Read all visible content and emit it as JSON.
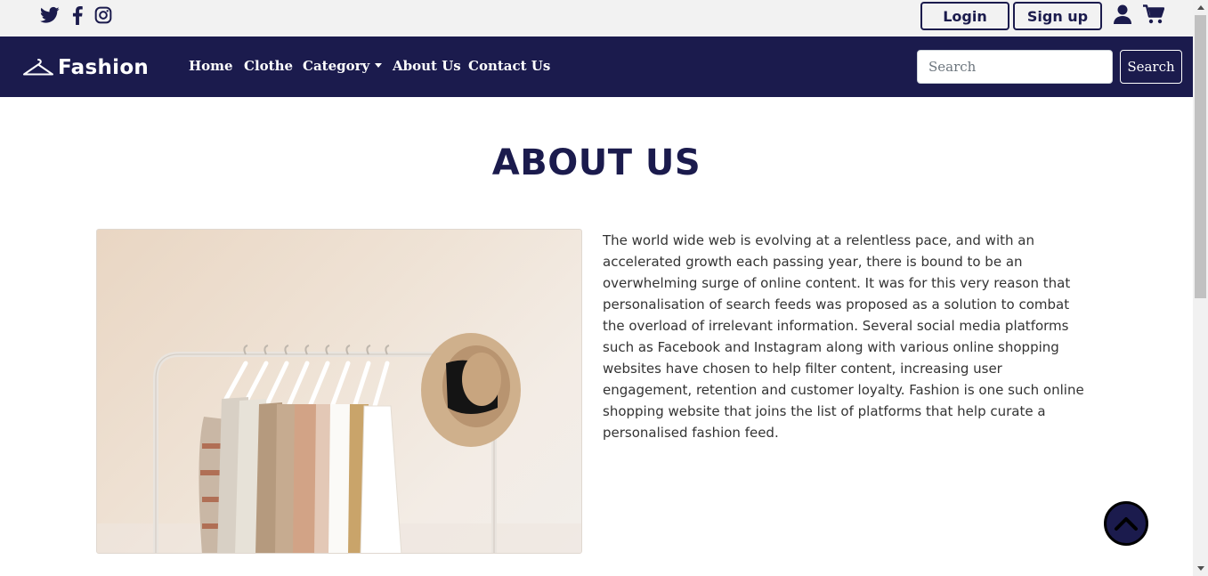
{
  "topbar": {
    "social": [
      {
        "name": "twitter-icon"
      },
      {
        "name": "facebook-icon"
      },
      {
        "name": "instagram-icon"
      }
    ],
    "login_label": "Login",
    "signup_label": "Sign up",
    "user_icon": "user-icon",
    "cart_icon": "cart-icon"
  },
  "navbar": {
    "brand": "Fashion",
    "links": [
      "Home",
      "Clothe",
      "Category",
      "About Us",
      "Contact Us"
    ],
    "search_placeholder": "Search",
    "search_button": "Search"
  },
  "main": {
    "title": "ABOUT US",
    "image_alt": "Clothing rack with shirts and a straw hat",
    "paragraph": "The world wide web is evolving at a relentless pace, and with an accelerated growth each passing year, there is bound to be an overwhelming surge of online content. It was for this very reason that personalisation of search feeds was proposed as a solution to combat the overload of irrelevant information. Several social media platforms such as Facebook and Instagram along with various online shopping websites have chosen to help filter content, increasing user engagement, retention and customer loyalty. Fashion is one such online shopping website that joins the list of platforms that help curate a personalised fashion feed."
  },
  "colors": {
    "brand_navy": "#1b1b4d",
    "topbar_bg": "#f2f2f2",
    "text": "#333333"
  },
  "back_to_top_icon": "chevron-up-icon"
}
